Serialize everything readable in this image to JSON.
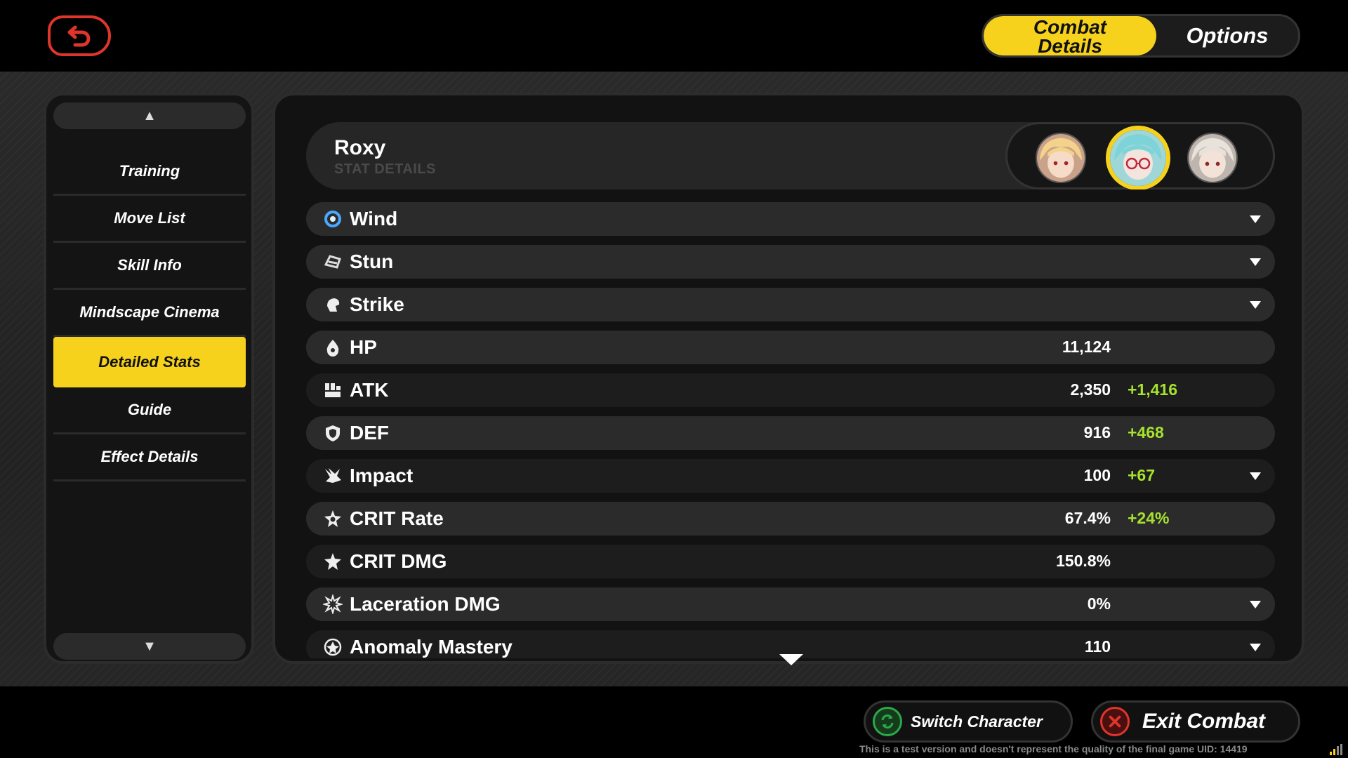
{
  "top": {
    "mode_tabs": [
      {
        "label": "Combat\nDetails",
        "active": true
      },
      {
        "label": "Options",
        "active": false
      }
    ]
  },
  "sidebar": {
    "items": [
      {
        "label": "Training"
      },
      {
        "label": "Move List"
      },
      {
        "label": "Skill Info"
      },
      {
        "label": "Mindscape Cinema"
      },
      {
        "label": "Detailed Stats",
        "active": true
      },
      {
        "label": "Guide"
      },
      {
        "label": "Effect Details"
      }
    ]
  },
  "character": {
    "name": "Roxy",
    "subtitle": "STAT DETAILS",
    "portraits": [
      {
        "icon": "blonde-character-portrait",
        "selected": false
      },
      {
        "icon": "teal-hair-glasses-portrait",
        "selected": true
      },
      {
        "icon": "silver-hair-portrait",
        "selected": false
      }
    ]
  },
  "stats": [
    {
      "label": "Wind",
      "icon": "wind-icon",
      "value": "",
      "bonus": "",
      "expandable": true
    },
    {
      "label": "Stun",
      "icon": "stun-icon",
      "value": "",
      "bonus": "",
      "expandable": true
    },
    {
      "label": "Strike",
      "icon": "strike-icon",
      "value": "",
      "bonus": "",
      "expandable": true
    },
    {
      "label": "HP",
      "icon": "hp-icon",
      "value": "11,124",
      "bonus": "",
      "expandable": false
    },
    {
      "label": "ATK",
      "icon": "atk-icon",
      "value": "2,350",
      "bonus": "+1,416",
      "expandable": false
    },
    {
      "label": "DEF",
      "icon": "def-icon",
      "value": "916",
      "bonus": "+468",
      "expandable": false
    },
    {
      "label": "Impact",
      "icon": "impact-icon",
      "value": "100",
      "bonus": "+67",
      "expandable": true
    },
    {
      "label": "CRIT Rate",
      "icon": "crit-rate-icon",
      "value": "67.4%",
      "bonus": "+24%",
      "expandable": false
    },
    {
      "label": "CRIT DMG",
      "icon": "crit-dmg-icon",
      "value": "150.8%",
      "bonus": "",
      "expandable": false
    },
    {
      "label": "Laceration DMG",
      "icon": "laceration-icon",
      "value": "0%",
      "bonus": "",
      "expandable": true
    },
    {
      "label": "Anomaly Mastery",
      "icon": "anomaly-mastery-icon",
      "value": "110",
      "bonus": "",
      "expandable": true
    }
  ],
  "bottom": {
    "switch_label": "Switch Character",
    "exit_label": "Exit Combat",
    "disclaimer": "This is a test version and doesn't represent the quality of the final game UID: 14419"
  },
  "colors": {
    "accent": "#f6d21c",
    "bonus": "#a6e22e",
    "back": "#e0352b",
    "switch": "#2aa84a"
  }
}
